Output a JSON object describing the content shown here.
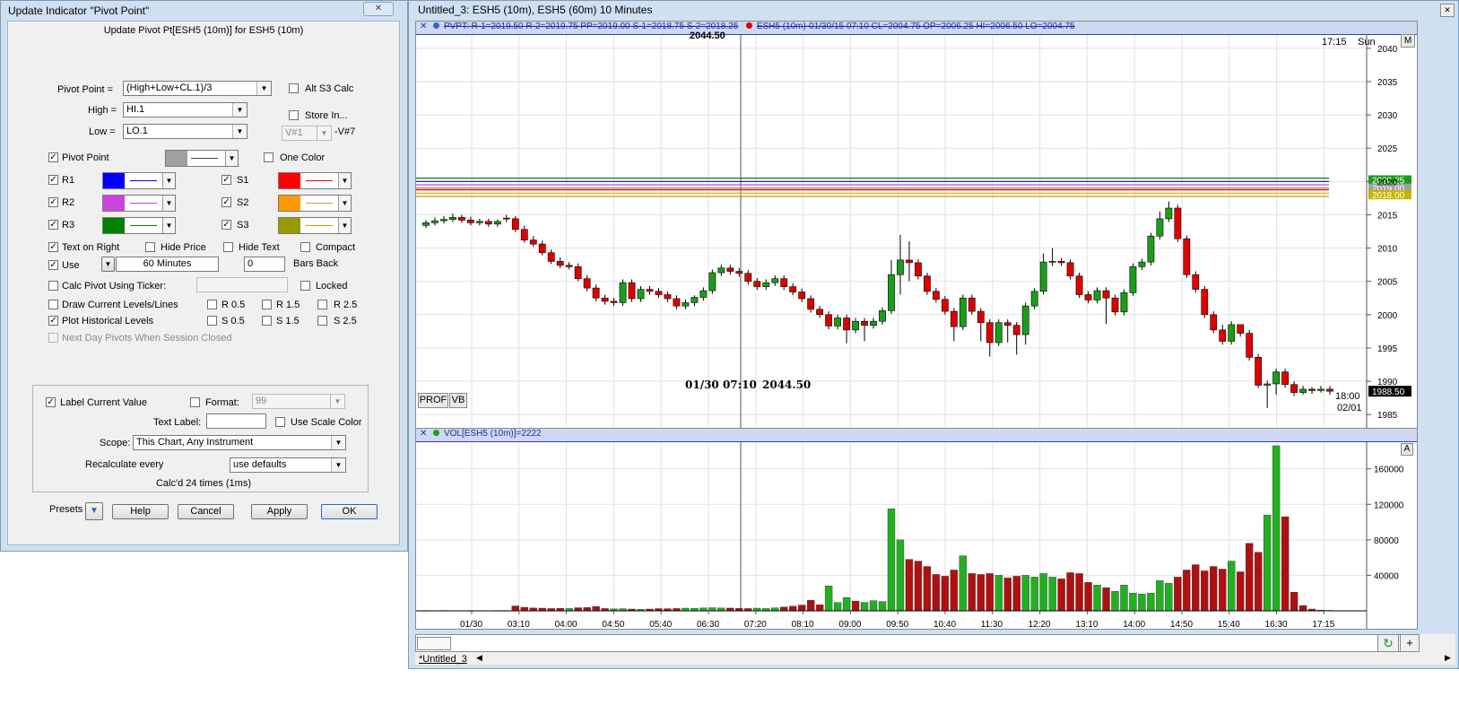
{
  "dialog": {
    "title": "Update Indicator \"Pivot Point\"",
    "close_glyph": "✕",
    "subtitle": "Update Pivot Pt[ESH5 (10m)]  for ESH5 (10m)",
    "pivot_point_label": "Pivot Point =",
    "pivot_point_value": "(High+Low+CL.1)/3",
    "alt_s3_label": "Alt S3 Calc",
    "high_label": "High =",
    "high_value": "HI.1",
    "low_label": "Low =",
    "low_value": "LO.1",
    "store_in_label": "Store In...",
    "store_var_value": "V#1",
    "store_var_suffix": "-V#7",
    "pivot_point_check_label": "Pivot Point",
    "one_color_label": "One Color",
    "r1_label": "R1",
    "r2_label": "R2",
    "r3_label": "R3",
    "s1_label": "S1",
    "s2_label": "S2",
    "s3_label": "S3",
    "text_on_right_label": "Text on Right",
    "hide_price_label": "Hide Price",
    "hide_text_label": "Hide Text",
    "compact_label": "Compact",
    "use_label": "Use",
    "use_value": "60 Minutes",
    "bars_back_value": "0",
    "bars_back_label": "Bars Back",
    "calc_pivot_ticker_label": "Calc Pivot Using Ticker:",
    "locked_label": "Locked",
    "draw_current_label": "Draw Current Levels/Lines",
    "plot_historical_label": "Plot Historical Levels",
    "r05_label": "R 0.5",
    "r15_label": "R 1.5",
    "r25_label": "R 2.5",
    "s05_label": "S 0.5",
    "s15_label": "S 1.5",
    "s25_label": "S 2.5",
    "next_day_label": "Next Day Pivots When Session Closed",
    "label_current_value_label": "Label Current Value",
    "format_label": "Format:",
    "format_value": "99",
    "text_label_label": "Text Label:",
    "text_label_value": "",
    "use_scale_color_label": "Use Scale Color",
    "scope_label": "Scope:",
    "scope_value": "This Chart, Any Instrument",
    "recalc_label": "Recalculate every",
    "recalc_value": "use defaults",
    "calcd_text": "Calc'd 24 times (1ms)",
    "presets_label": "Presets",
    "help_label": "Help",
    "cancel_label": "Cancel",
    "apply_label": "Apply",
    "ok_label": "OK",
    "check_glyph": "✓",
    "arrow_glyph": "▼",
    "colors": {
      "pivot": "#a0a0a0",
      "r1": "#0000ff",
      "r2": "#cc44dd",
      "r3": "#008000",
      "s1": "#ff0000",
      "s2": "#ff9900",
      "s3": "#999900",
      "pivot_line": "#404040",
      "r1_line": "#0000ff",
      "r2_line": "#cc44dd",
      "r3_line": "#008000",
      "s1_line": "#ff0000",
      "s2_line": "#c8a060",
      "s3_line": "#c0a000"
    }
  },
  "chart": {
    "window_title": "Untitled_3: ESH5 (10m), ESH5 (60m) 10 Minutes",
    "close_glyph": "✕",
    "price_header": "PVPT: R-1=2019.50 R-2=2019.75 PP=2019.00 S-1=2018.75 S-2=2018.25",
    "price_header_2": "ESH5 (10m)-01/30/15 07:10 CL=2004.75 OP=2006.25 HI=2006.50 LO=2004.75",
    "cursor_time_label": "01/30 07:10",
    "cursor_price_label": "2044.50",
    "cursor_top_label": "2044.50",
    "time_label": "17:15",
    "day_label": "Sun",
    "m_button": "M",
    "prof_button": "PROF",
    "vb_button": "VB",
    "end_time_label": "18:00",
    "end_date_label": "02/01",
    "vol_header": "VOL[ESH5 (10m)]=2222",
    "a_button": "A",
    "tab_label": "*Untitled_3",
    "plus_button": "+",
    "refresh_glyph": "↻",
    "scroll_left": "◀",
    "scroll_right": "▶",
    "colors": {
      "up": "#1a9e1a",
      "down": "#e00000",
      "vol_up": "#22b022",
      "vol_down": "#b01010"
    }
  },
  "chart_data": {
    "type": "candlestick",
    "price_axis_ticks": [
      2040,
      2035,
      2030,
      2025,
      2020,
      2015,
      2010,
      2005,
      2000,
      1995,
      1990,
      1985
    ],
    "price_range": [
      1983,
      2042
    ],
    "level_labels": [
      {
        "value": 2020.25,
        "label": "2020.25",
        "color": "#1a9e1a"
      },
      {
        "value": 2019.0,
        "label": "2019.00",
        "color": "#a0a0a0"
      },
      {
        "value": 2018.0,
        "label": "2018.00",
        "color": "#c8b400"
      }
    ],
    "levels": [
      {
        "value": 2020.5,
        "color": "#008000"
      },
      {
        "value": 2020.0,
        "color": "#0000ff"
      },
      {
        "value": 2019.5,
        "color": "#cc44dd"
      },
      {
        "value": 2019.0,
        "color": "#808080"
      },
      {
        "value": 2018.75,
        "color": "#ff0000"
      },
      {
        "value": 2018.25,
        "color": "#ff9900"
      },
      {
        "value": 2017.75,
        "color": "#c0a000"
      }
    ],
    "last_price_label": "1988.50",
    "time_labels": [
      "01/30",
      "03:10",
      "04:00",
      "04:50",
      "05:40",
      "06:30",
      "07:20",
      "08:10",
      "09:00",
      "09:50",
      "10:40",
      "11:30",
      "12:20",
      "13:10",
      "14:00",
      "14:50",
      "15:40",
      "16:30",
      "17:15"
    ],
    "closes": [
      2013.8,
      2014.1,
      2014.3,
      2014.6,
      2014.2,
      2013.8,
      2014.0,
      2013.6,
      2014.0,
      2014.4,
      2012.8,
      2011.2,
      2010.6,
      2009.3,
      2008.0,
      2007.4,
      2007.2,
      2005.4,
      2004.0,
      2002.5,
      2002.0,
      2001.8,
      2004.8,
      2002.4,
      2003.8,
      2003.5,
      2003.0,
      2002.4,
      2001.3,
      2001.8,
      2002.6,
      2003.6,
      2006.3,
      2007.0,
      2006.5,
      2006.2,
      2005.0,
      2004.2,
      2004.8,
      2005.4,
      2004.2,
      2003.4,
      2002.4,
      2000.8,
      2000.0,
      1998.3,
      1999.5,
      1997.7,
      1999.0,
      1998.4,
      1999.0,
      2000.6,
      2006.0,
      2008.2,
      2007.8,
      2005.8,
      2003.5,
      2002.3,
      2000.5,
      1998.2,
      2002.5,
      2000.5,
      1998.8,
      1995.8,
      1998.8,
      1998.4,
      1997.0,
      2001.3,
      2003.5,
      2007.9,
      2008.0,
      2007.8,
      2005.8,
      2003.0,
      2002.2,
      2003.6,
      2002.5,
      2000.4,
      2003.3,
      2007.2,
      2007.9,
      2011.8,
      2014.4,
      2016.0,
      2011.4,
      2006.0,
      2003.8,
      2000.0,
      1997.7,
      1996.0,
      1998.5,
      1997.2,
      1993.6,
      1989.4,
      1989.6,
      1991.4,
      1989.5,
      1988.3,
      1988.8,
      1988.6,
      1988.8,
      1988.5
    ],
    "opens": [
      2013.4,
      2013.8,
      2014.1,
      2014.3,
      2014.6,
      2014.2,
      2013.8,
      2014.0,
      2013.6,
      2014.5,
      2014.4,
      2012.8,
      2011.2,
      2010.6,
      2009.3,
      2008.0,
      2007.4,
      2007.2,
      2005.4,
      2004.0,
      2002.5,
      2002.0,
      2001.8,
      2004.8,
      2002.4,
      2003.8,
      2003.5,
      2003.0,
      2002.4,
      2001.3,
      2001.8,
      2002.6,
      2003.6,
      2006.3,
      2007.0,
      2006.5,
      2006.2,
      2005.0,
      2004.2,
      2004.8,
      2005.4,
      2004.2,
      2003.4,
      2002.4,
      2000.8,
      2000.0,
      1998.3,
      1999.5,
      1997.7,
      1999.0,
      1998.4,
      1999.0,
      2000.6,
      2006.0,
      2008.2,
      2007.8,
      2005.8,
      2003.5,
      2002.3,
      2000.5,
      1998.2,
      2002.5,
      2000.5,
      1998.8,
      1995.8,
      1998.8,
      1998.4,
      1997.0,
      2001.3,
      2003.5,
      2007.9,
      2008.0,
      2007.8,
      2005.8,
      2003.0,
      2002.2,
      2003.6,
      2002.5,
      2000.4,
      2003.3,
      2007.2,
      2007.9,
      2011.8,
      2014.4,
      2016.0,
      2011.4,
      2006.0,
      2003.8,
      2000.0,
      1997.7,
      1996.0,
      1998.5,
      1997.2,
      1993.6,
      1989.4,
      1989.6,
      1991.4,
      1989.5,
      1988.3,
      1988.8,
      1988.6,
      1988.8
    ],
    "highs": [
      2014.2,
      2014.6,
      2014.8,
      2015.2,
      2015.0,
      2014.7,
      2014.4,
      2014.4,
      2014.3,
      2015.0,
      2014.8,
      2013.4,
      2011.8,
      2011.1,
      2009.8,
      2008.6,
      2007.9,
      2007.7,
      2005.9,
      2004.5,
      2003.0,
      2002.5,
      2005.3,
      2005.3,
      2004.3,
      2004.3,
      2004.0,
      2003.5,
      2002.9,
      2002.3,
      2002.9,
      2004.1,
      2006.8,
      2007.5,
      2007.5,
      2007.0,
      2006.7,
      2005.5,
      2005.3,
      2005.9,
      2005.9,
      2004.7,
      2003.9,
      2002.9,
      2001.3,
      2000.5,
      2000.0,
      2000.0,
      1999.5,
      1999.5,
      1999.5,
      2001.1,
      2008.2,
      2012.0,
      2011.0,
      2008.3,
      2006.3,
      2004.0,
      2002.8,
      2001.0,
      2003.0,
      2003.0,
      2001.0,
      1999.3,
      1999.3,
      1999.3,
      1998.9,
      2001.8,
      2004.0,
      2009.2,
      2010.0,
      2008.5,
      2008.3,
      2006.3,
      2003.5,
      2004.1,
      2004.1,
      2003.0,
      2003.8,
      2007.7,
      2008.4,
      2012.3,
      2015.5,
      2017.0,
      2016.5,
      2011.9,
      2006.5,
      2004.3,
      2000.5,
      1998.5,
      1999.0,
      1998.5,
      1997.7,
      1994.1,
      1990.1,
      1991.9,
      1991.9,
      1990.0,
      1989.3,
      1989.1,
      1989.3,
      1989.3
    ],
    "lows": [
      2013.0,
      2013.4,
      2013.7,
      2013.9,
      2013.8,
      2013.4,
      2013.4,
      2013.2,
      2013.2,
      2013.9,
      2012.4,
      2010.8,
      2010.2,
      2008.9,
      2007.6,
      2007.0,
      2006.8,
      2005.0,
      2003.5,
      2002.0,
      2001.5,
      2001.3,
      2001.3,
      2001.9,
      2001.9,
      2003.0,
      2002.5,
      2001.9,
      2000.8,
      2000.8,
      2001.3,
      2002.1,
      2003.1,
      2005.8,
      2006.0,
      2005.7,
      2004.5,
      2003.7,
      2003.7,
      2004.3,
      2003.7,
      2002.9,
      2001.9,
      2000.3,
      1999.5,
      1997.8,
      1997.8,
      1995.7,
      1997.2,
      1996.0,
      1997.9,
      1998.5,
      2000.1,
      2003.0,
      2005.0,
      2005.3,
      2003.0,
      2001.8,
      2000.0,
      1996.0,
      1997.7,
      2000.0,
      1996.0,
      1993.7,
      1995.3,
      1995.8,
      1994.0,
      1995.5,
      2000.8,
      2003.0,
      2007.3,
      2007.3,
      2005.3,
      2002.5,
      2001.7,
      2001.7,
      1998.6,
      1999.9,
      1999.9,
      2002.8,
      2006.7,
      2007.4,
      2011.3,
      2013.9,
      2010.9,
      2005.5,
      2003.3,
      1999.5,
      1997.2,
      1995.5,
      1995.5,
      1996.7,
      1993.1,
      1989.0,
      1986.0,
      1988.0,
      1989.0,
      1987.8,
      1988.0,
      1988.1,
      1988.3,
      1988.0
    ],
    "volume_axis_ticks": [
      160000,
      120000,
      80000,
      40000
    ],
    "volume_range": [
      0,
      190000
    ],
    "volumes": [
      200,
      300,
      400,
      300,
      300,
      200,
      300,
      300,
      200,
      200,
      5500,
      4000,
      3200,
      3000,
      2600,
      2800,
      2600,
      3500,
      3700,
      4800,
      2600,
      2200,
      2400,
      2000,
      1800,
      2000,
      2500,
      2400,
      2600,
      3000,
      2800,
      3200,
      3500,
      3200,
      3100,
      2800,
      2600,
      3000,
      2600,
      3400,
      4200,
      5200,
      6500,
      12000,
      6800,
      28000,
      9300,
      15000,
      11000,
      9500,
      11500,
      10500,
      115000,
      80000,
      58000,
      56000,
      50000,
      41000,
      39000,
      46000,
      62000,
      42000,
      41000,
      42000,
      40000,
      37000,
      39000,
      40000,
      38000,
      42000,
      38000,
      36000,
      43000,
      42000,
      32000,
      29000,
      26000,
      22000,
      29000,
      20000,
      19000,
      20000,
      34000,
      31000,
      38000,
      46000,
      52000,
      45000,
      50000,
      47000,
      56000,
      44000,
      76000,
      66000,
      108000,
      186000,
      106000,
      21000,
      6000,
      2000,
      800,
      500
    ],
    "volume_up": [
      1,
      1,
      1,
      1,
      1,
      1,
      1,
      1,
      1,
      1,
      0,
      0,
      0,
      0,
      0,
      0,
      1,
      0,
      0,
      0,
      0,
      1,
      1,
      0,
      1,
      0,
      0,
      0,
      0,
      1,
      1,
      1,
      1,
      1,
      0,
      0,
      0,
      1,
      1,
      1,
      0,
      0,
      0,
      0,
      0,
      1,
      1,
      1,
      0,
      1,
      1,
      1,
      1,
      1,
      0,
      0,
      0,
      0,
      0,
      0,
      1,
      0,
      0,
      0,
      1,
      0,
      0,
      1,
      1,
      1,
      1,
      0,
      0,
      0,
      0,
      1,
      0,
      1,
      1,
      1,
      1,
      1,
      1,
      1,
      0,
      0,
      0,
      0,
      0,
      0,
      1,
      0,
      0,
      0,
      1,
      1,
      0,
      0,
      0,
      0,
      0,
      1
    ]
  }
}
